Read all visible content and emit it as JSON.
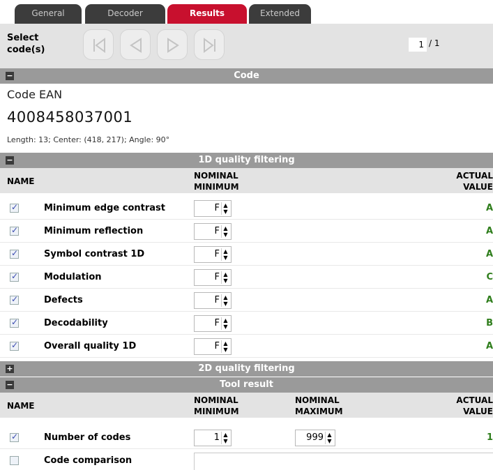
{
  "tabs": [
    {
      "label": "General",
      "active": false
    },
    {
      "label": "Decoder",
      "active": false
    },
    {
      "label": "Results",
      "active": true
    },
    {
      "label": "Extended",
      "active": false
    }
  ],
  "toolbar": {
    "select_label": "Select code(s)",
    "page_value": "1",
    "page_total": "/ 1"
  },
  "code_section": {
    "title": "Code",
    "type": "Code EAN",
    "value": "4008458037001",
    "info": "Length: 13; Center: (418, 217); Angle: 90°"
  },
  "quality_1d": {
    "title": "1D quality filtering",
    "headers": {
      "name": "NAME",
      "nominal_min": "NOMINAL MINIMUM",
      "actual": "ACTUAL VALUE"
    },
    "rows": [
      {
        "name": "Minimum edge contrast",
        "checked": true,
        "nominal_min": "F",
        "actual": "A"
      },
      {
        "name": "Minimum reflection",
        "checked": true,
        "nominal_min": "F",
        "actual": "A"
      },
      {
        "name": "Symbol contrast 1D",
        "checked": true,
        "nominal_min": "F",
        "actual": "A"
      },
      {
        "name": "Modulation",
        "checked": true,
        "nominal_min": "F",
        "actual": "C"
      },
      {
        "name": "Defects",
        "checked": true,
        "nominal_min": "F",
        "actual": "A"
      },
      {
        "name": "Decodability",
        "checked": true,
        "nominal_min": "F",
        "actual": "B"
      },
      {
        "name": "Overall quality 1D",
        "checked": true,
        "nominal_min": "F",
        "actual": "A"
      }
    ]
  },
  "quality_2d": {
    "title": "2D quality filtering"
  },
  "tool_result": {
    "title": "Tool result",
    "headers": {
      "name": "NAME",
      "nominal_min": "NOMINAL MINIMUM",
      "nominal_max": "NOMINAL MAXIMUM",
      "actual": "ACTUAL VALUE"
    },
    "rows": [
      {
        "name": "Number of codes",
        "checked": true,
        "nominal_min": "1",
        "nominal_max": "999",
        "actual": "1"
      },
      {
        "name": "Code comparison",
        "checked": false
      }
    ]
  },
  "colors": {
    "accent": "#c8102e",
    "tab_bg": "#3c3c3c",
    "section_bg": "#9a9a9a",
    "pass_green": "#2e7d1b"
  }
}
